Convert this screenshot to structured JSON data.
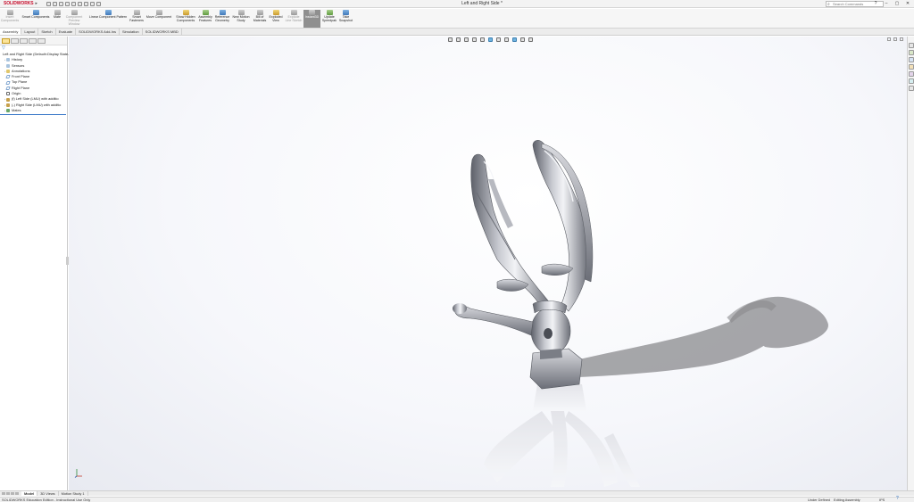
{
  "app": {
    "name": "SOLIDWORKS",
    "document_title": "Left and Right Side *",
    "search_placeholder": "Search Commands",
    "window_controls": [
      "?",
      "–",
      "▢",
      "✕"
    ]
  },
  "ribbon": {
    "tools": [
      {
        "label": "Insert Components",
        "state": "disabled"
      },
      {
        "label": "Smart Components",
        "state": "normal"
      },
      {
        "label": "Mate",
        "state": "normal"
      },
      {
        "label": "Component Preview Window",
        "state": "disabled"
      },
      {
        "label": "Linear Component Pattern",
        "state": "normal"
      },
      {
        "label": "Smart Fasteners",
        "state": "normal"
      },
      {
        "label": "Move Component",
        "state": "normal"
      },
      {
        "label": "Show Hidden Components",
        "state": "normal"
      },
      {
        "label": "Assembly Features",
        "state": "normal"
      },
      {
        "label": "Reference Geometry",
        "state": "normal"
      },
      {
        "label": "New Motion Study",
        "state": "normal"
      },
      {
        "label": "Bill of Materials",
        "state": "normal"
      },
      {
        "label": "Exploded View",
        "state": "normal"
      },
      {
        "label": "Explode Line Sketch",
        "state": "disabled"
      },
      {
        "label": "Instant3D",
        "state": "active"
      },
      {
        "label": "Update Speedpak",
        "state": "normal"
      },
      {
        "label": "Take Snapshot",
        "state": "normal"
      }
    ]
  },
  "command_tabs": [
    "Assembly",
    "Layout",
    "Sketch",
    "Evaluate",
    "SOLIDWORKS Add-Ins",
    "Simulation",
    "SOLIDWORKS MBD"
  ],
  "feature_tree": {
    "items": [
      {
        "label": "Left and Right Side  (Default<Display State-1>)",
        "icon": "assembly-icon",
        "indent": 0,
        "expander": ""
      },
      {
        "label": "History",
        "icon": "folder-icon",
        "indent": 1,
        "expander": "›"
      },
      {
        "label": "Sensors",
        "icon": "folder-icon",
        "indent": 1,
        "expander": ""
      },
      {
        "label": "Annotations",
        "icon": "annotation-icon",
        "indent": 1,
        "expander": "›"
      },
      {
        "label": "Front Plane",
        "icon": "plane-icon",
        "indent": 1,
        "expander": ""
      },
      {
        "label": "Top Plane",
        "icon": "plane-icon",
        "indent": 1,
        "expander": ""
      },
      {
        "label": "Right Plane",
        "icon": "plane-icon",
        "indent": 1,
        "expander": ""
      },
      {
        "label": "Origin",
        "icon": "origin-icon",
        "indent": 1,
        "expander": ""
      },
      {
        "label": "(f) Left Side (LMU) with additio",
        "icon": "part-icon",
        "indent": 1,
        "expander": "›"
      },
      {
        "label": "(-) Right Side (LMU) with additio",
        "icon": "part-icon",
        "indent": 1,
        "expander": "›"
      },
      {
        "label": "Mates",
        "icon": "mates-icon",
        "indent": 1,
        "expander": "›"
      }
    ]
  },
  "bottom_tabs": [
    "Model",
    "3D Views",
    "Motion Study 1"
  ],
  "status": {
    "left": "SOLIDWORKS Education Edition - Instructional Use Only",
    "definition": "Under Defined",
    "mode": "Editing Assembly",
    "units": "IPS"
  },
  "colors": {
    "brand": "#c8102e",
    "selection_blue": "#3a78c8",
    "model_metal": "#8a8d96"
  }
}
